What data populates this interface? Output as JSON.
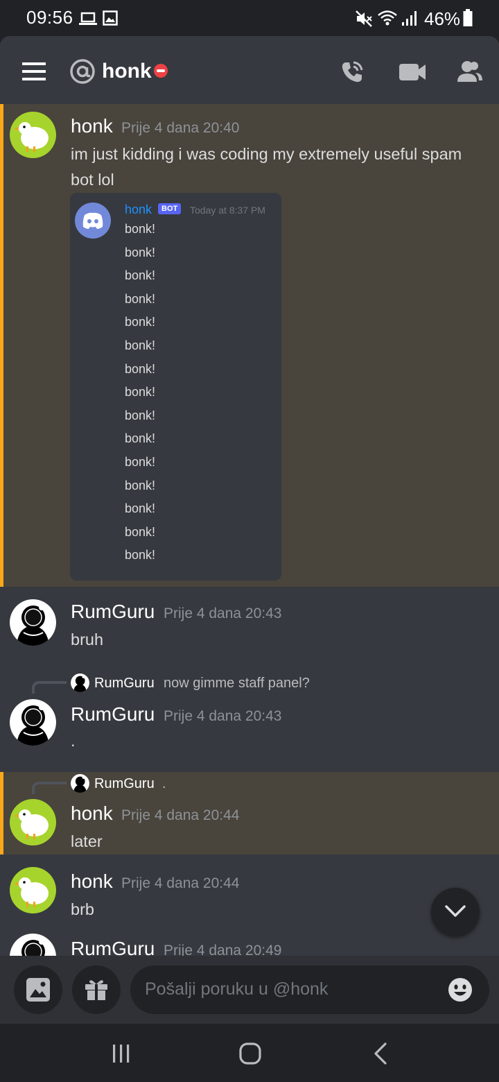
{
  "status_bar": {
    "time": "09:56",
    "battery": "46%"
  },
  "header": {
    "at_symbol": "@",
    "title": "honk"
  },
  "messages": [
    {
      "user": "honk",
      "time": "Prije 4 dana 20:40",
      "text": "im just kidding i was coding my extremely useful spam bot lol"
    },
    {
      "user": "RumGuru",
      "time": "Prije 4 dana 20:43",
      "text": "bruh"
    },
    {
      "reply_user": "RumGuru",
      "reply_text": "now gimme staff panel?",
      "user": "RumGuru",
      "time": "Prije 4 dana 20:43",
      "text": "."
    },
    {
      "reply_user": "RumGuru",
      "reply_text": ".",
      "user": "honk",
      "time": "Prije 4 dana 20:44",
      "text": "later"
    },
    {
      "user": "honk",
      "time": "Prije 4 dana 20:44",
      "text": "brb"
    },
    {
      "user": "RumGuru",
      "time": "Prije 4 dana 20:49"
    }
  ],
  "embed": {
    "name": "honk",
    "badge": "BOT",
    "time": "Today at 8:37 PM",
    "lines": [
      "bonk!",
      "bonk!",
      "bonk!",
      "bonk!",
      "bonk!",
      "bonk!",
      "bonk!",
      "bonk!",
      "bonk!",
      "bonk!",
      "bonk!",
      "bonk!",
      "bonk!",
      "bonk!",
      "bonk!"
    ]
  },
  "composer": {
    "placeholder": "Pošalji poruku u @honk"
  },
  "colors": {
    "mention_bg": "#49443c",
    "mention_bar": "#faa81a",
    "honk_avatar": "#a7d32d",
    "dnd": "#ed4245"
  }
}
